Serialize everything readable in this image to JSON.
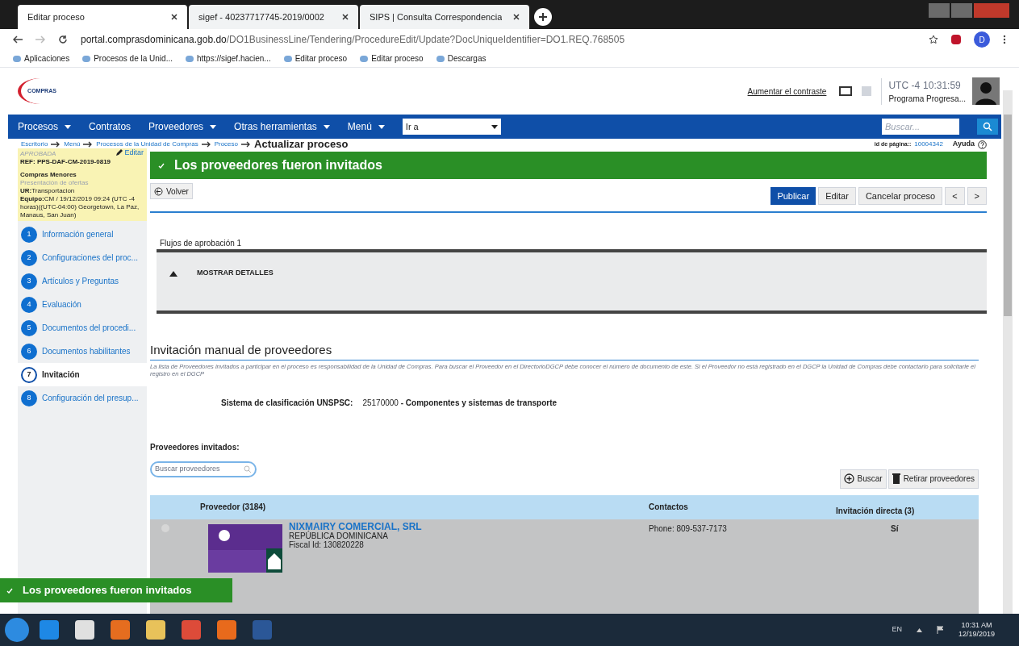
{
  "browser": {
    "tabs": [
      {
        "title": "Editar proceso",
        "selected": true
      },
      {
        "title": "sigef - 40237717745-2019/0002",
        "selected": false
      },
      {
        "title": "SIPS | Consulta Correspondencia",
        "selected": false
      }
    ],
    "url_host": "portal.comprasdominicana.gob.do",
    "url_path": "/DO1BusinessLine/Tendering/ProcedureEdit/Update?DocUniqueIdentifier=DO1.REQ.768505",
    "profile_initial": "D",
    "bookmarks": [
      "Aplicaciones",
      "Procesos de la Unid...",
      "https://sigef.hacien...",
      "Editar proceso",
      "Editar proceso",
      "Descargas"
    ]
  },
  "header": {
    "logo_text": "COMPRAS",
    "contrast_link": "Aumentar el contraste",
    "timezone": "UTC -4",
    "clock": "10:31:59",
    "user": "Programa Progresa..."
  },
  "nav": {
    "items": [
      {
        "label": "Procesos",
        "dropdown": true
      },
      {
        "label": "Contratos",
        "dropdown": false
      },
      {
        "label": "Proveedores",
        "dropdown": true
      },
      {
        "label": "Otras herramientas",
        "dropdown": true
      },
      {
        "label": "Menú",
        "dropdown": true
      }
    ],
    "goto_value": "Ir a",
    "search_placeholder": "Buscar..."
  },
  "breadcrumb": {
    "links": [
      "Escritorio",
      "Menú",
      "Procesos de la Unidad de Compras",
      "Proceso"
    ],
    "current": "Actualizar proceso"
  },
  "page_id_label": "id de página::",
  "page_id": "10004342",
  "help": "Ayuda",
  "summary": {
    "status": "APROBADA",
    "edit": "Editar",
    "ref": "REF: PPS-DAF-CM-2019-0819",
    "type": "Compras Menores",
    "phase": "Presentación de ofertas",
    "ur_label": "UR:",
    "ur": "Transportacion",
    "team_label": "Equipo:",
    "team": "CM / 19/12/2019 09:24 (UTC -4 horas)((UTC-04:00) Georgetown, La Paz, Manaus, San Juan)"
  },
  "steps": [
    {
      "number": "1",
      "label": "Información general",
      "selected": false
    },
    {
      "number": "2",
      "label": "Configuraciones del proc...",
      "selected": false
    },
    {
      "number": "3",
      "label": "Artículos y Preguntas",
      "selected": false
    },
    {
      "number": "4",
      "label": "Evaluación",
      "selected": false
    },
    {
      "number": "5",
      "label": "Documentos del procedi...",
      "selected": false
    },
    {
      "number": "6",
      "label": "Documentos habilitantes",
      "selected": false
    },
    {
      "number": "7",
      "label": "Invitación",
      "selected": true
    },
    {
      "number": "8",
      "label": "Configuración del presup...",
      "selected": false
    }
  ],
  "banner": "Los proveedores fueron invitados",
  "back_button": "Volver",
  "actions": [
    {
      "label": "Publicar",
      "primary": true
    },
    {
      "label": "Editar",
      "primary": false
    },
    {
      "label": "Cancelar proceso",
      "primary": false
    },
    {
      "label": "<",
      "primary": false
    },
    {
      "label": ">",
      "primary": false
    }
  ],
  "approval": {
    "title": "Flujos de aprobación 1",
    "toggle": "MOSTRAR DETALLES"
  },
  "invitation": {
    "title": "Invitación manual de proveedores",
    "description": "La lista de Proveedores invitados a participar en el proceso es responsabilidad de la Unidad de Compras. Para buscar el Proveedor en el DirectorioDGCP debe conocer el número de documento de este. Si el Proveedor no está registrado en el DGCP la Unidad de Compras debe contactarlo para solicitarle el registro en el DGCP",
    "unspsc_label": "Sistema de clasificación UNSPSC:",
    "unspsc_code": "25170000",
    "unspsc_name": "- Componentes y sistemas de transporte",
    "list_title": "Proveedores invitados:",
    "search_placeholder": "Buscar proveedores",
    "search_button": "Buscar",
    "remove_button": "Retirar proveedores"
  },
  "table": {
    "columns": [
      "Proveedor (3184)",
      "Contactos",
      "Invitación directa (3)"
    ],
    "rows": [
      {
        "checked": false,
        "name": "NIXMAIRY COMERCIAL, SRL",
        "country": "REPÚBLICA DOMINICANA",
        "fiscal": "Fiscal Id: 130820228",
        "phone": "Phone: 809-537-7173",
        "direct": "Sí"
      }
    ]
  },
  "toast": "Los proveedores fueron invitados",
  "taskbar": {
    "language": "EN",
    "time": "10:31 AM",
    "date": "12/19/2019"
  }
}
